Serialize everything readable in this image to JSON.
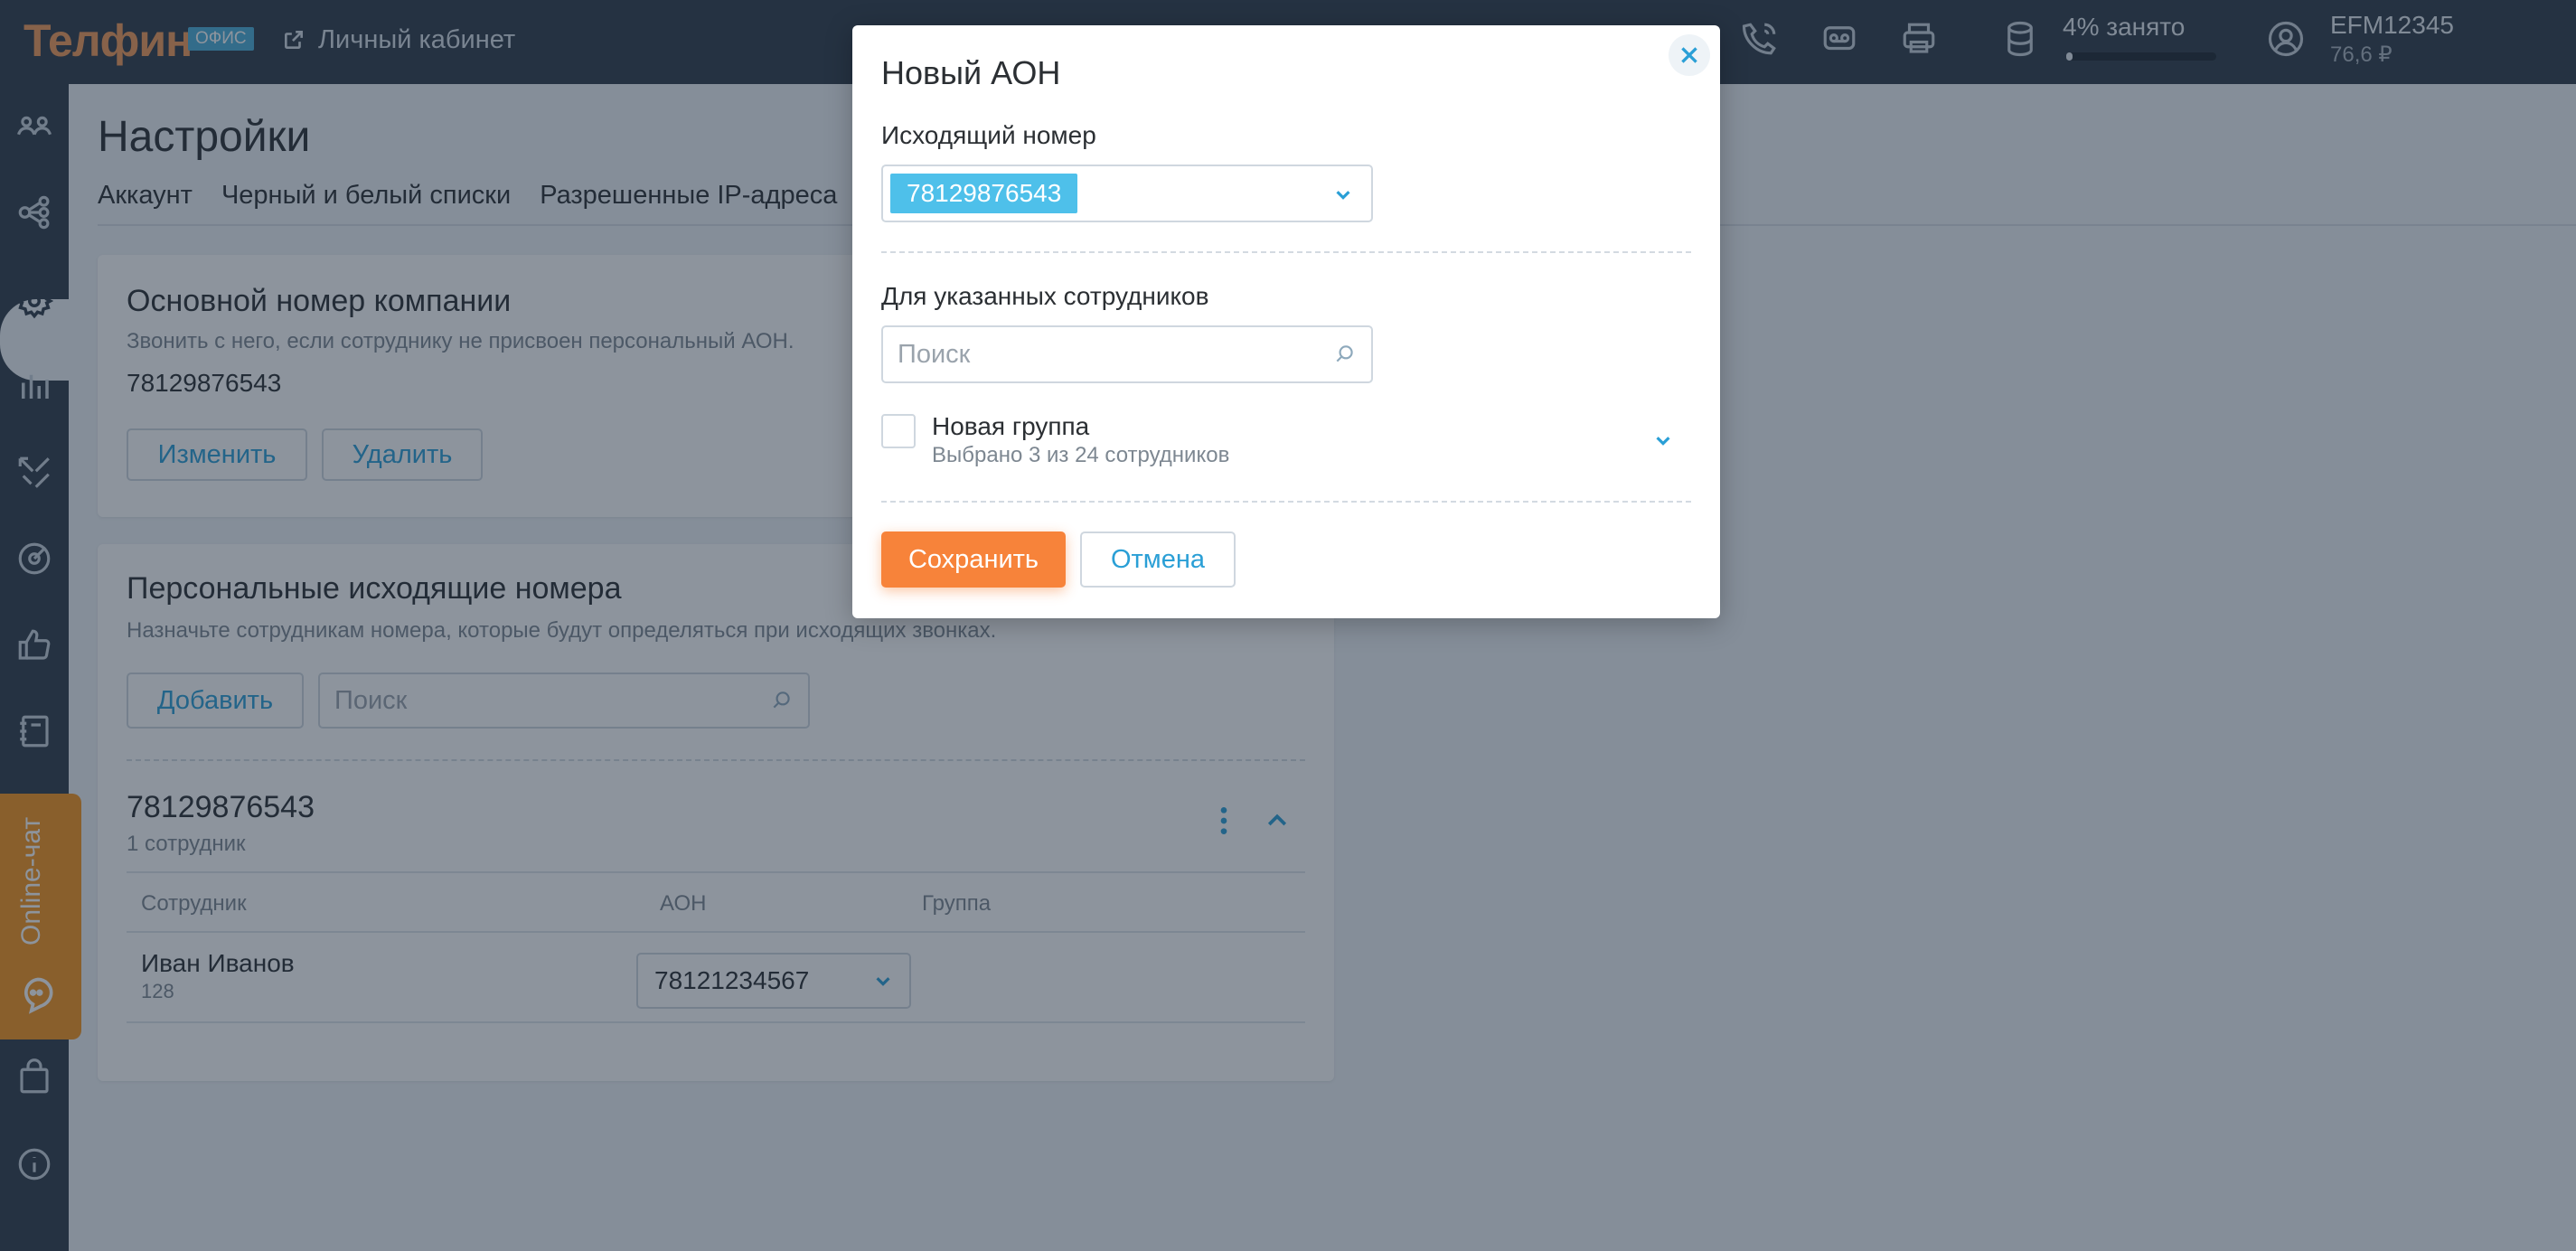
{
  "header": {
    "logo": "Телфин",
    "logo_badge": "ОФИС",
    "cabinet_link": "Личный кабинет",
    "storage_text": "4% занято",
    "storage_used_percent": 4,
    "account_id": "EFM12345",
    "balance": "76,6 ₽",
    "icons": [
      "phone-call-icon",
      "voicemail-icon",
      "fax-icon",
      "database-icon",
      "user-circle-icon"
    ]
  },
  "sidebar": {
    "icons": [
      "contacts-icon",
      "routing-icon",
      "settings-icon",
      "stats-icon",
      "calls-icon",
      "target-icon",
      "like-icon",
      "notebook-icon",
      "bag-icon",
      "info-icon"
    ],
    "active": "settings-icon",
    "online_chat": "Online-чат"
  },
  "page": {
    "title": "Настройки",
    "tabs": [
      "Аккаунт",
      "Черный и белый списки",
      "Разрешенные IP-адреса"
    ]
  },
  "company_number": {
    "title": "Основной номер компании",
    "description": "Звонить с него, если сотруднику не присвоен персональный АОН.",
    "number": "78129876543",
    "change_label": "Изменить",
    "delete_label": "Удалить"
  },
  "personal_numbers": {
    "title": "Персональные исходящие номера",
    "description": "Назначьте сотрудникам номера, которые будут определяться при исходящих звонках.",
    "add_label": "Добавить",
    "search_placeholder": "Поиск",
    "group": {
      "number": "78129876543",
      "count_text": "1 сотрудник",
      "columns": [
        "Сотрудник",
        "АОН",
        "Группа"
      ],
      "rows": [
        {
          "name": "Иван Иванов",
          "ext": "128",
          "aon": "78121234567",
          "group": ""
        }
      ]
    }
  },
  "modal": {
    "title": "Новый АОН",
    "outgoing_label": "Исходящий номер",
    "selected_number": "78129876543",
    "employees_label": "Для указанных сотрудников",
    "search_placeholder": "Поиск",
    "group_name": "Новая группа",
    "group_selected": "Выбрано 3 из 24 сотрудников",
    "save_label": "Сохранить",
    "cancel_label": "Отмена"
  },
  "colors": {
    "accent_blue": "#2a9fd6",
    "chip_blue": "#4ec0ea",
    "primary_orange": "#f7833a",
    "chat_orange": "#f7941d",
    "topbar": "#2f3b48"
  }
}
